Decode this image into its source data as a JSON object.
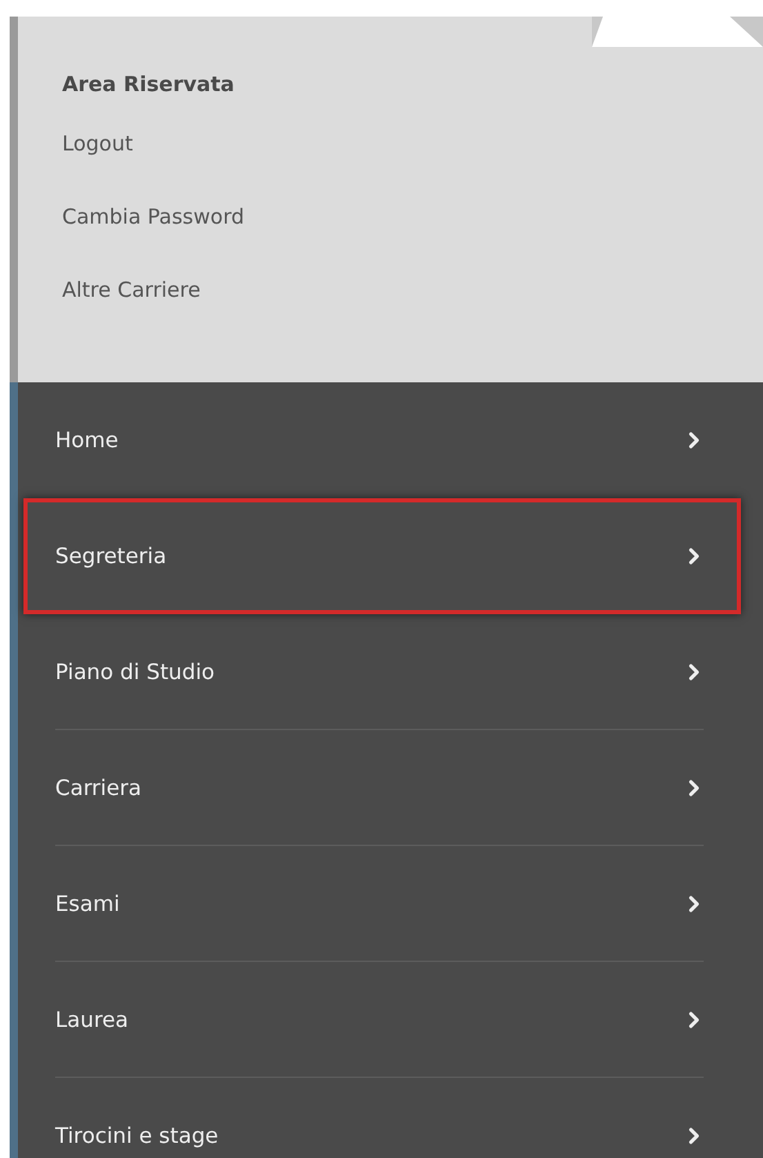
{
  "user_area": {
    "title": "Area Riservata",
    "links": [
      "Logout",
      "Cambia Password",
      "Altre Carriere"
    ]
  },
  "menu": [
    {
      "label": "Home",
      "highlighted": false
    },
    {
      "label": "Segreteria",
      "highlighted": true
    },
    {
      "label": "Piano di Studio",
      "highlighted": false
    },
    {
      "label": "Carriera",
      "highlighted": false
    },
    {
      "label": "Esami",
      "highlighted": false
    },
    {
      "label": "Laurea",
      "highlighted": false
    },
    {
      "label": "Tirocini e stage",
      "highlighted": false
    }
  ]
}
